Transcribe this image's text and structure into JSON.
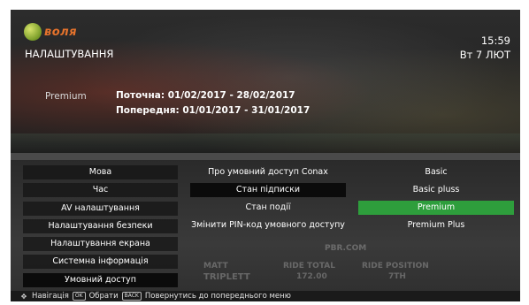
{
  "header": {
    "logo_text": "воля",
    "title": "НАЛАШТУВАННЯ",
    "time": "15:59",
    "date": "Вт 7 ЛЮТ"
  },
  "subscription": {
    "plan": "Premium",
    "current_period": "Поточна: 01/02/2017 - 28/02/2017",
    "previous_period": "Попередня: 01/01/2017 - 31/01/2017"
  },
  "menu": {
    "main_items": [
      "Мова",
      "Час",
      "AV налаштування",
      "Налаштування безпеки",
      "Налаштування екрана",
      "Системна інформація",
      "Умовний доступ"
    ],
    "ca_items": [
      "Про умовний доступ Conax",
      "Стан підписки",
      "Стан події",
      "Змінити PIN-код умовного доступу"
    ],
    "packages": [
      "Basic",
      "Basic pluss",
      "Premium",
      "Premium Plus"
    ]
  },
  "background_text": {
    "site": "PBR.COM",
    "col1": "MATT",
    "col1b": "TRIPLETT",
    "col2": "RIDE TOTAL",
    "col2b": "172.00",
    "col3": "RIDE POSITION",
    "col3b": "7TH"
  },
  "footer": {
    "navigate": "Навігація",
    "select_key": "OK",
    "select": "Обрати",
    "back_key": "BACK",
    "back": "Повернутись до попереднього меню"
  },
  "colors": {
    "active": "#2e9e3c",
    "logo": "#e6732c"
  }
}
